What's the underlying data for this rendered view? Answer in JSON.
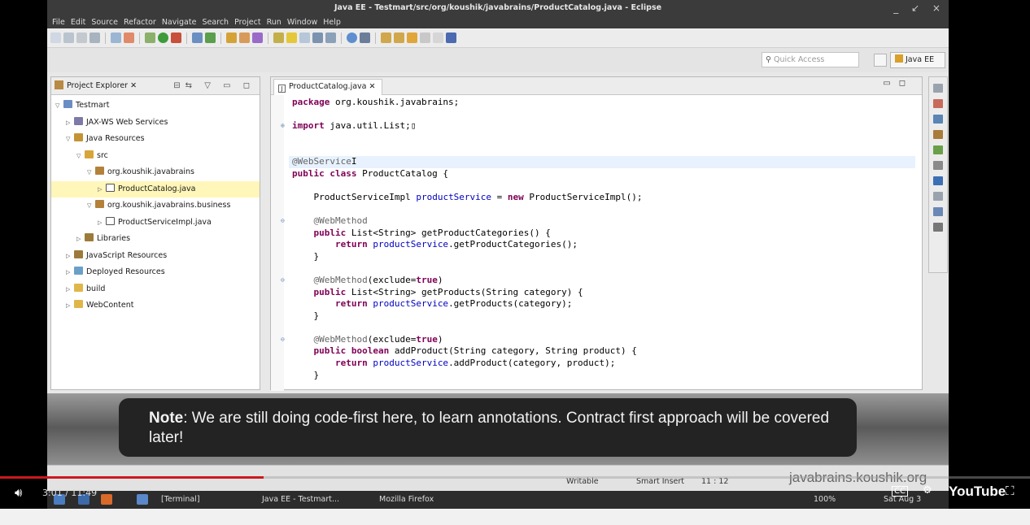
{
  "window": {
    "title": "Java EE - Testmart/src/org/koushik/javabrains/ProductCatalog.java - Eclipse",
    "controls": "_ ↙ ×"
  },
  "menu": [
    "File",
    "Edit",
    "Source",
    "Refactor",
    "Navigate",
    "Search",
    "Project",
    "Run",
    "Window",
    "Help"
  ],
  "toolbar": {
    "quick_access_placeholder": "Quick Access",
    "perspective": "Java EE"
  },
  "explorer": {
    "tab_label": "Project Explorer ✕",
    "tree": [
      {
        "label": "Testmart",
        "arrow": "▽",
        "depth": 0,
        "icon_color": "#6a8dc4"
      },
      {
        "label": "JAX-WS Web Services",
        "arrow": "▷",
        "depth": 1,
        "icon_color": "#7d7aa8"
      },
      {
        "label": "Java Resources",
        "arrow": "▽",
        "depth": 1,
        "icon_color": "#c49434"
      },
      {
        "label": "src",
        "arrow": "▽",
        "depth": 2,
        "icon_color": "#d8a53a"
      },
      {
        "label": "org.koushik.javabrains",
        "arrow": "▽",
        "depth": 3,
        "icon_color": "#b4813a"
      },
      {
        "label": "ProductCatalog.java",
        "arrow": "▷",
        "depth": 4,
        "icon_color": "#ffffff",
        "selected": true
      },
      {
        "label": "org.koushik.javabrains.business",
        "arrow": "▽",
        "depth": 3,
        "icon_color": "#b4813a"
      },
      {
        "label": "ProductServiceImpl.java",
        "arrow": "▷",
        "depth": 4,
        "icon_color": "#ffffff"
      },
      {
        "label": "Libraries",
        "arrow": "▷",
        "depth": 2,
        "icon_color": "#9c7b3a"
      },
      {
        "label": "JavaScript Resources",
        "arrow": "▷",
        "depth": 1,
        "icon_color": "#9c7b3a"
      },
      {
        "label": "Deployed Resources",
        "arrow": "▷",
        "depth": 1,
        "icon_color": "#6aa0c8"
      },
      {
        "label": "build",
        "arrow": "▷",
        "depth": 1,
        "icon_color": "#e0b64a"
      },
      {
        "label": "WebContent",
        "arrow": "▷",
        "depth": 1,
        "icon_color": "#e0b64a"
      }
    ]
  },
  "editor": {
    "tab_label": "ProductCatalog.java ✕",
    "lines": [
      [
        {
          "t": "package ",
          "c": "kw"
        },
        {
          "t": "org.koushik.javabrains;"
        }
      ],
      [],
      [
        {
          "t": "import ",
          "c": "kw"
        },
        {
          "t": "java.util.List;▯"
        }
      ],
      [],
      [],
      [
        {
          "t": "@WebService",
          "c": "an"
        },
        {
          "t": "I"
        }
      ],
      [
        {
          "t": "public class ",
          "c": "kw"
        },
        {
          "t": "ProductCatalog {"
        }
      ],
      [],
      [
        {
          "t": "    ProductServiceImpl "
        },
        {
          "t": "productService",
          "c": "fd"
        },
        {
          "t": " = "
        },
        {
          "t": "new ",
          "c": "kw"
        },
        {
          "t": "ProductServiceImpl();"
        }
      ],
      [],
      [
        {
          "t": "    @WebMethod",
          "c": "an"
        }
      ],
      [
        {
          "t": "    public ",
          "c": "kw"
        },
        {
          "t": "List<String> getProductCategories() {"
        }
      ],
      [
        {
          "t": "        return ",
          "c": "kw"
        },
        {
          "t": "productService",
          "c": "fd"
        },
        {
          "t": ".getProductCategories();"
        }
      ],
      [
        {
          "t": "    }"
        }
      ],
      [],
      [
        {
          "t": "    @WebMethod",
          "c": "an"
        },
        {
          "t": "(exclude="
        },
        {
          "t": "true",
          "c": "kw"
        },
        {
          "t": ")"
        }
      ],
      [
        {
          "t": "    public ",
          "c": "kw"
        },
        {
          "t": "List<String> getProducts(String category) {"
        }
      ],
      [
        {
          "t": "        return ",
          "c": "kw"
        },
        {
          "t": "productService",
          "c": "fd"
        },
        {
          "t": ".getProducts(category);"
        }
      ],
      [
        {
          "t": "    }"
        }
      ],
      [],
      [
        {
          "t": "    @WebMethod",
          "c": "an"
        },
        {
          "t": "(exclude="
        },
        {
          "t": "true",
          "c": "kw"
        },
        {
          "t": ")"
        }
      ],
      [
        {
          "t": "    public boolean ",
          "c": "kw"
        },
        {
          "t": "addProduct(String category, String product) {"
        }
      ],
      [
        {
          "t": "        return ",
          "c": "kw"
        },
        {
          "t": "productService",
          "c": "fd"
        },
        {
          "t": ".addProduct(category, product);"
        }
      ],
      [
        {
          "t": "    }"
        }
      ],
      [],
      [
        {
          "t": "}"
        }
      ]
    ],
    "highlight_line": 5,
    "fold_lines": [
      2,
      10,
      15,
      20
    ]
  },
  "status": {
    "writable": "Writable",
    "insert_mode": "Smart Insert",
    "position": "11 : 12"
  },
  "taskbar": {
    "terminal": "[Terminal]",
    "eclipse": "Java EE - Testmart...",
    "firefox": "Mozilla Firefox",
    "battery": "100%",
    "date": "Sat Aug 3"
  },
  "watermark": "javabrains.koushik.org",
  "annotation": {
    "bold": "Note",
    "text": ": We are still doing code-first here, to learn annotations. Contract first approach will be covered later!"
  },
  "player": {
    "time": "3:01 / 11:49",
    "progress": 0.256,
    "brand": "YouTube"
  }
}
